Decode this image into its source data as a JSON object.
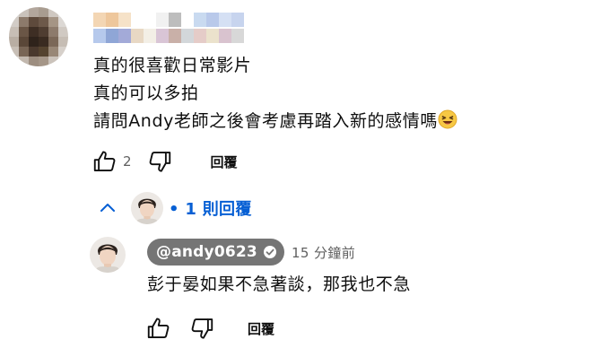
{
  "comment": {
    "lines": [
      "真的很喜歡日常影片",
      "真的可以多拍",
      "請問Andy老師之後會考慮再踏入新的感情嗎"
    ],
    "emoji": "😆",
    "like_count": "2",
    "reply_label": "回覆",
    "icons": {
      "like": "thumb-up-icon",
      "dislike": "thumb-down-icon",
      "avatar": "blurred-avatar"
    }
  },
  "replies_toggle": {
    "text": "• 1 則回覆",
    "icon": "chevron-up-icon",
    "color": "#065fd4"
  },
  "reply": {
    "author": "@andy0623",
    "verified_icon": "verified-check-icon",
    "timestamp": "15 分鐘前",
    "text": "彭于晏如果不急著談，那我也不急",
    "reply_label": "回覆",
    "pill_color": "#757575"
  }
}
